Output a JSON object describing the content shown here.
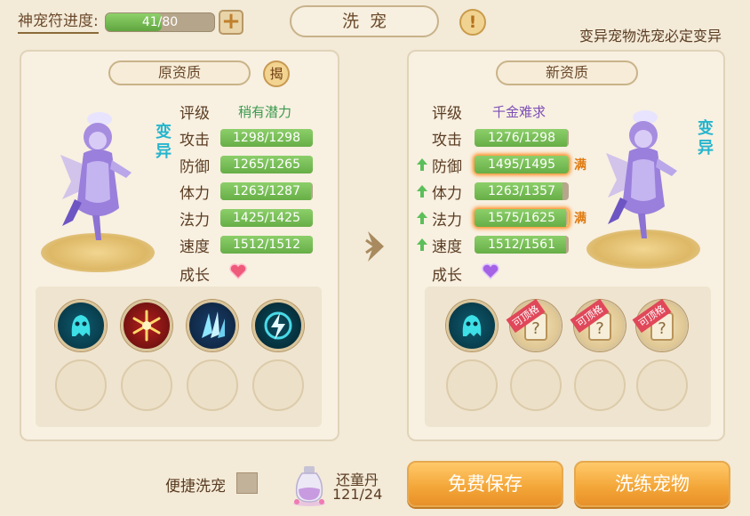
{
  "topbar": {
    "progress_label": "神宠符进度:",
    "progress_text": "41/80",
    "progress_fraction": 0.5125,
    "plus_label": "+",
    "title": "洗宠",
    "info_label": "!",
    "note": "变异宠物洗宠必定变异"
  },
  "left_panel": {
    "header": "原资质",
    "reveal_label": "揭",
    "mutant_label": "变异",
    "grade_label": "评级",
    "grade_value": "稍有潜力",
    "stats": [
      {
        "label": "攻击",
        "text": "1298/1298",
        "fraction": 1.0
      },
      {
        "label": "防御",
        "text": "1265/1265",
        "fraction": 1.0
      },
      {
        "label": "体力",
        "text": "1263/1287",
        "fraction": 0.98
      },
      {
        "label": "法力",
        "text": "1425/1425",
        "fraction": 1.0
      },
      {
        "label": "速度",
        "text": "1512/1512",
        "fraction": 1.0
      }
    ],
    "growth_label": "成长",
    "growth_icon": "red-heart-icon",
    "skills": [
      "ghost-skill-icon",
      "snowflake-skill-icon",
      "ice-crystal-skill-icon",
      "lightning-skill-icon"
    ]
  },
  "right_panel": {
    "header": "新资质",
    "mutant_label": "变异",
    "grade_label": "评级",
    "grade_value": "千金难求",
    "stats": [
      {
        "label": "攻击",
        "text": "1276/1298",
        "fraction": 0.98,
        "up": false,
        "full": false
      },
      {
        "label": "防御",
        "text": "1495/1495",
        "fraction": 1.0,
        "up": true,
        "full": true
      },
      {
        "label": "体力",
        "text": "1263/1357",
        "fraction": 0.93,
        "up": true,
        "full": false
      },
      {
        "label": "法力",
        "text": "1575/1625",
        "fraction": 0.97,
        "up": true,
        "full": true
      },
      {
        "label": "速度",
        "text": "1512/1561",
        "fraction": 0.97,
        "up": true,
        "full": false
      }
    ],
    "full_tag": "满",
    "growth_label": "成长",
    "growth_icon": "purple-heart-icon",
    "scroll_tag": "可顶格"
  },
  "bottom": {
    "quick_wash_label": "便捷洗宠",
    "item_name": "还童丹",
    "item_count": "121/24",
    "save_button": "免费保存",
    "wash_button": "洗练宠物"
  },
  "colors": {
    "accent_green": "#6cb34a",
    "mutant_cyan": "#26b5ce",
    "button_orange": "#f3a536",
    "full_orange": "#e07a10"
  }
}
